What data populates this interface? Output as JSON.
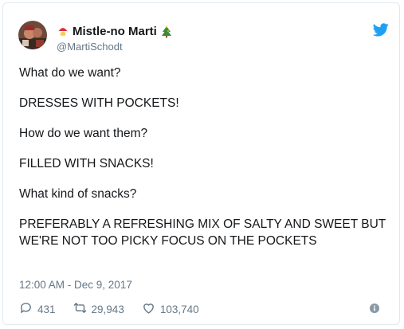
{
  "author": {
    "display_name": "Mistle-no Marti",
    "handle": "@MartiSchodt",
    "emoji_prefix": "santa-emoji",
    "emoji_suffix": "christmas-tree-emoji"
  },
  "tweet": {
    "lines": [
      "What do we want?",
      "DRESSES WITH POCKETS!",
      "How do we want them?",
      "FILLED WITH SNACKS!",
      "What kind of snacks?",
      "PREFERABLY A REFRESHING MIX OF SALTY AND SWEET BUT WE'RE NOT TOO PICKY FOCUS ON THE POCKETS"
    ],
    "timestamp": "12:00 AM - Dec 9, 2017"
  },
  "actions": {
    "replies": "431",
    "retweets": "29,943",
    "likes": "103,740"
  },
  "colors": {
    "brand": "#1da1f2",
    "text": "#14171a",
    "muted": "#657786",
    "border": "#e1e8ed"
  },
  "icons": {
    "brand": "twitter-bird-icon",
    "reply": "reply-icon",
    "retweet": "retweet-icon",
    "like": "heart-icon",
    "info": "info-icon"
  }
}
